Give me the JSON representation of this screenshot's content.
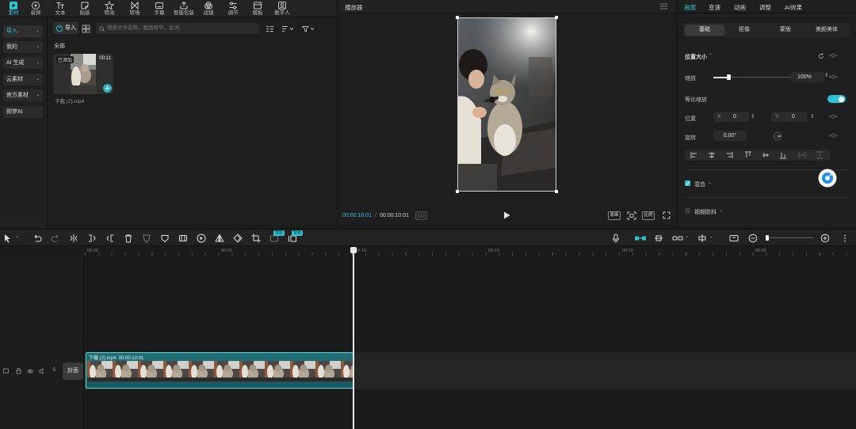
{
  "toolbar": {
    "items": [
      {
        "label": "素材",
        "icon": "media-icon"
      },
      {
        "label": "音频",
        "icon": "audio-icon"
      },
      {
        "label": "文本",
        "icon": "text-icon"
      },
      {
        "label": "贴纸",
        "icon": "sticker-icon"
      },
      {
        "label": "特效",
        "icon": "effects-icon"
      },
      {
        "label": "转场",
        "icon": "transition-icon"
      },
      {
        "label": "字幕",
        "icon": "caption-icon"
      },
      {
        "label": "智能包装",
        "icon": "smart-package-icon"
      },
      {
        "label": "滤镜",
        "icon": "filter-icon"
      },
      {
        "label": "调节",
        "icon": "adjust-icon"
      },
      {
        "label": "模板",
        "icon": "template-icon"
      },
      {
        "label": "数字人",
        "icon": "avatar-icon"
      }
    ],
    "active_color": "#2cc4d4"
  },
  "left_nav": [
    {
      "label": "导入",
      "active": true
    },
    {
      "label": "我的"
    },
    {
      "label": "AI 生成"
    },
    {
      "label": "云素材"
    },
    {
      "label": "官方素材"
    },
    {
      "label": "即梦AI"
    }
  ],
  "media_panel": {
    "import_label": "导入",
    "search_placeholder": "搜索文件名称、画面帧节、台词",
    "section_label": "全部",
    "asset": {
      "badge": "已添加",
      "duration": "00:11",
      "filename": "下载 (2).mp4"
    }
  },
  "player": {
    "title": "播放器",
    "current_time": "00:00:10:01",
    "total_time": "00:00:10:01",
    "btn_original": "原画",
    "btn_ratio": "比例"
  },
  "inspector": {
    "tabs": [
      "画面",
      "变速",
      "动画",
      "调整",
      "AI效果"
    ],
    "subtabs": [
      "基础",
      "抠像",
      "蒙版",
      "美颜美体"
    ],
    "section_position": "位置大小",
    "scale_label": "缩放",
    "scale_value": "100%",
    "scale_level": 0.2,
    "uniform_scale_label": "等比缩放",
    "position_label": "位置",
    "x_label": "X",
    "x_value": "0",
    "y_label": "Y",
    "y_value": "0",
    "rotation_label": "旋转",
    "rotation_value": "0.00°",
    "blend_label": "混合",
    "stabilize_label": "视频防抖"
  },
  "timeline": {
    "ruler_ticks": [
      "00:00",
      "00:05",
      "00:10",
      "00:15",
      "00:20",
      "00:25"
    ],
    "badge_a": "智能",
    "badge_b": "智能",
    "cover_label": "封面",
    "clip": {
      "name": "下载 (2).mp4",
      "duration": "00:00:10:01"
    }
  }
}
